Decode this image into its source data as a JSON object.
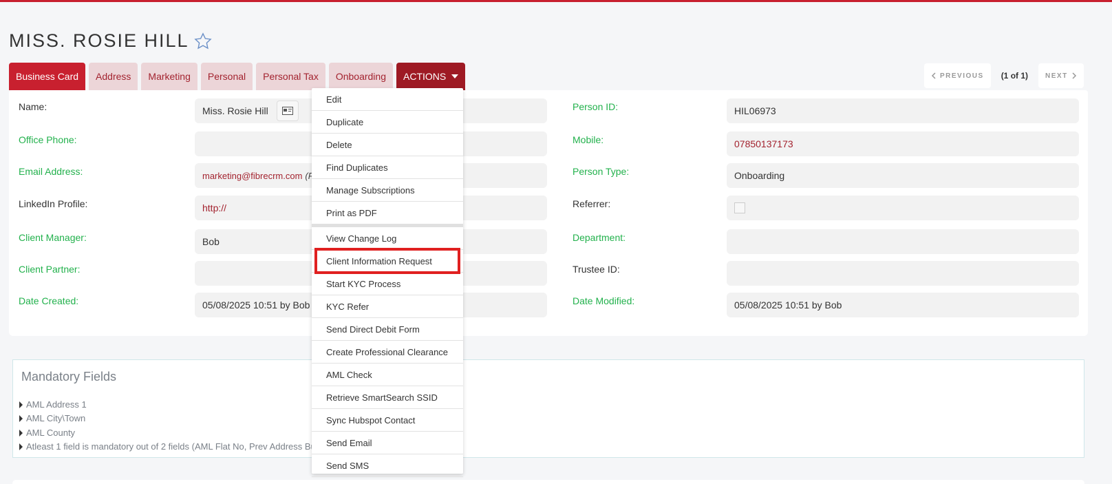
{
  "page": {
    "title": "MISS. ROSIE HILL"
  },
  "colors": {
    "accent": "#c8202f",
    "tab_inactive_bg": "#ecd5d8",
    "actions_bg": "#9e1a24",
    "label_green": "#22b14c",
    "highlight": "#e02020"
  },
  "tabs": [
    {
      "label": "Business Card",
      "active": true
    },
    {
      "label": "Address"
    },
    {
      "label": "Marketing"
    },
    {
      "label": "Personal"
    },
    {
      "label": "Personal Tax"
    },
    {
      "label": "Onboarding"
    },
    {
      "label": "ACTIONS"
    }
  ],
  "pager": {
    "previous": "PREVIOUS",
    "count": "(1 of 1)",
    "next": "NEXT"
  },
  "fields": {
    "name": {
      "label": "Name:",
      "value": "Miss. Rosie Hill"
    },
    "office_phone": {
      "label": "Office Phone:",
      "value": ""
    },
    "email": {
      "label": "Email Address:",
      "value": "marketing@fibrecrm.com",
      "suffix": "(P"
    },
    "linkedin": {
      "label": "LinkedIn Profile:",
      "value": "http://"
    },
    "client_manager": {
      "label": "Client Manager:",
      "value": "Bob"
    },
    "client_partner": {
      "label": "Client Partner:",
      "value": ""
    },
    "date_created": {
      "label": "Date Created:",
      "value": "05/08/2025 10:51 by Bob"
    },
    "person_id": {
      "label": "Person ID:",
      "value": "HIL06973"
    },
    "mobile": {
      "label": "Mobile:",
      "value": "07850137173"
    },
    "person_type": {
      "label": "Person Type:",
      "value": "Onboarding"
    },
    "referrer": {
      "label": "Referrer:"
    },
    "department": {
      "label": "Department:",
      "value": ""
    },
    "trustee_id": {
      "label": "Trustee ID:",
      "value": ""
    },
    "date_modified": {
      "label": "Date Modified:",
      "value": "05/08/2025 10:51 by Bob"
    }
  },
  "mandatory": {
    "title": "Mandatory Fields",
    "items": [
      "AML Address 1",
      "AML City\\Town",
      "AML County",
      "Atleast 1 field is mandatory out of 2 fields (AML Flat No, Prev Address Bu"
    ]
  },
  "actions_menu": {
    "items": [
      "Edit",
      "Duplicate",
      "Delete",
      "Find Duplicates",
      "Manage Subscriptions",
      "Print as PDF",
      "View Change Log",
      "Client Information Request",
      "Start KYC Process",
      "KYC Refer",
      "Send Direct Debit Form",
      "Create Professional Clearance",
      "AML Check",
      "Retrieve SmartSearch SSID",
      "Sync Hubspot Contact",
      "Send Email",
      "Send SMS"
    ],
    "highlighted": "Client Information Request"
  }
}
